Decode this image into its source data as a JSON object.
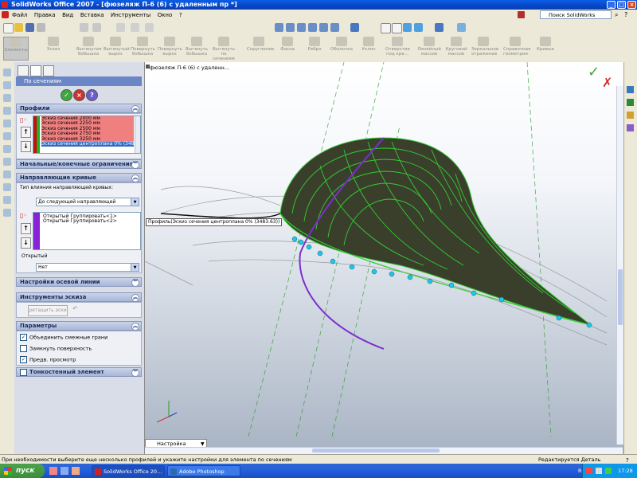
{
  "window": {
    "title": "SolidWorks Office 2007 - [фюзеляж П-6 (6) с удаленным пр *]",
    "controls": [
      "_",
      "□",
      "×"
    ]
  },
  "menu": {
    "items": [
      "Файл",
      "Правка",
      "Вид",
      "Вставка",
      "Инструменты",
      "Окно",
      "?"
    ],
    "search_label": "Поиск SolidWorks"
  },
  "commands": {
    "items": [
      "Элементы",
      "Эскиз",
      "Вытянутая бобышка",
      "Вытянутый вырез",
      "Повернуть бобышка",
      "Повернуть вырез",
      "Вытянуть бобышка",
      "Вытянуть по сечениям",
      "Скругление",
      "Фаска",
      "Ребро",
      "Оболочка",
      "Уклон",
      "Отверстие под кре...",
      "Линейный массив",
      "Круговой массив",
      "Зеркальное отражение",
      "Справочная геометрия",
      "Кривые"
    ]
  },
  "property_manager": {
    "title": "По сечениям",
    "profiles": {
      "header": "Профили",
      "items": [
        "Эскиз сечения 2000 мм",
        "Эскиз сечения 2250 мм",
        "Эскиз сечения 2500 мм",
        "Эскиз сечения 2750 мм",
        "Эскиз сечения 3250 мм",
        "Эскиз сечения центроплана 0% (348"
      ]
    },
    "start_end": {
      "header": "Начальные/конечные ограничения"
    },
    "guides": {
      "header": "Направляющие кривые",
      "influence_label": "Тип влияния направляющей кривых:",
      "influence_value": "До следующей направляющей",
      "items": [
        "Открытый Группировать<1>",
        "Открытый Группировать<2>"
      ],
      "open_label": "Открытый",
      "open_value": "Нет"
    },
    "centerline": {
      "header": "Настройки осевой линии"
    },
    "sketch_tools": {
      "header": "Инструменты эскиза",
      "drag_label": "ретащить эски"
    },
    "options": {
      "header": "Параметры",
      "merge": "Объединить смежные грани",
      "close": "Замкнуть поверхность",
      "preview": "Предв. просмотр",
      "merge_checked": true,
      "close_checked": false,
      "preview_checked": true
    },
    "thin": {
      "header": "Тонкостенный элемент"
    }
  },
  "viewport": {
    "doc_name": "фюзеляж П-6 (6) с удаленн...",
    "tooltip": "Профиль(Эскиз сечения центроплана 0% (3483.63))",
    "config_tab": "Настройка"
  },
  "status": {
    "message": "При необходимости выберите еще несколько профилей и укажите настройки для элемента по сечениям",
    "right": "Редактируется Деталь"
  },
  "taskbar": {
    "start": "пуск",
    "tasks": [
      "SolidWorks Office 20...",
      "Adobe Photoshop"
    ],
    "lang": "RU",
    "time": "17:28"
  },
  "colors": {
    "profile_highlight": "#f08080",
    "surface_green": "#33cc33",
    "guide_purple": "#7a2fd0",
    "point_cyan": "#1ec8e8"
  }
}
